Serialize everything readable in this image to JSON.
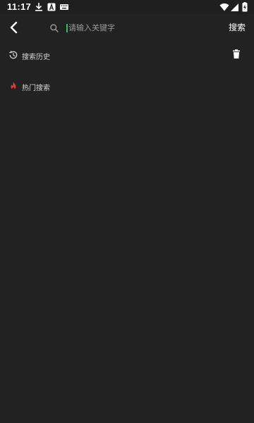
{
  "status_bar": {
    "time": "11:17",
    "icons": [
      "download-icon",
      "font-a-icon",
      "keyboard-icon",
      "wifi-icon",
      "cellular-signal-icon",
      "battery-charging-icon"
    ]
  },
  "search": {
    "placeholder": "请输入关键字",
    "value": "",
    "submit_label": "搜索"
  },
  "history": {
    "label": "搜索历史",
    "icon": "history-icon",
    "clear_icon": "trash-icon"
  },
  "hot": {
    "label": "热门搜索",
    "icon": "fire-icon"
  },
  "colors": {
    "background": "#222222",
    "caret": "#33bb66",
    "fire": "#e53935",
    "text": "#e6e6e6"
  }
}
